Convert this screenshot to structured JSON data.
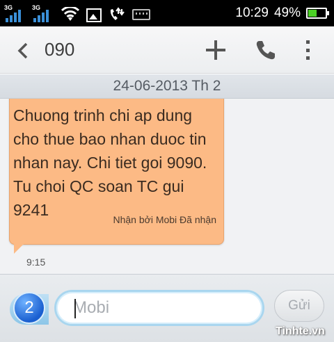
{
  "status_bar": {
    "network_1": "3G",
    "network_2": "3G",
    "time": "10:29",
    "battery_percent": "49%",
    "battery_level": 0.49,
    "icons": [
      "signal-sim1-icon",
      "signal-sim2-icon",
      "wifi-icon",
      "gallery-icon",
      "call-forward-icon",
      "keyboard-icon",
      "battery-icon"
    ]
  },
  "action_bar": {
    "title": "090",
    "icons": [
      "back-arrow-icon",
      "add-icon",
      "phone-icon",
      "overflow-menu-icon"
    ]
  },
  "conversation": {
    "date_header": "24-06-2013 Th 2",
    "messages": [
      {
        "text": "Chuong trinh chi ap dung cho thue bao nhan duoc tin nhan nay. Chi tiet goi 9090. Tu choi QC soan TC gui 9241",
        "status": "Nhận bởi Mobi Đã nhận",
        "time": "9:15"
      }
    ],
    "colors": {
      "incoming_bubble": "#fcba85"
    }
  },
  "compose": {
    "sim_number": "2",
    "placeholder": "Mobi",
    "value": "",
    "send_label": "Gửi"
  },
  "watermark": "Tinhte.vn"
}
